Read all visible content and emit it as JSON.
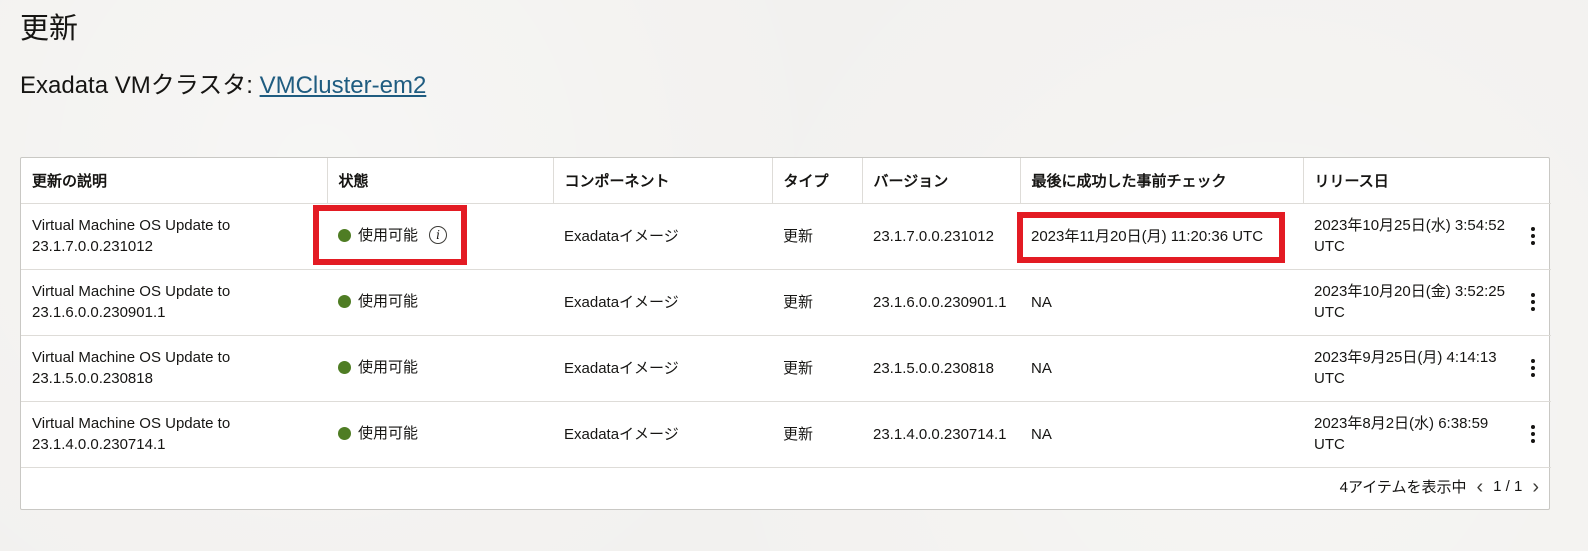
{
  "page": {
    "title": "更新",
    "subtitle_prefix": "Exadata VMクラスタ: ",
    "cluster_link": "VMCluster-em2"
  },
  "table": {
    "headers": [
      "更新の説明",
      "状態",
      "コンポーネント",
      "タイプ",
      "バージョン",
      "最後に成功した事前チェック",
      "リリース日"
    ],
    "rows": [
      {
        "desc_line1": "Virtual Machine OS Update to",
        "desc_line2": "23.1.7.0.0.231012",
        "status": "使用可能",
        "component": "Exadataイメージ",
        "type": "更新",
        "version": "23.1.7.0.0.231012",
        "precheck": "2023年11月20日(月) 11:20:36 UTC",
        "release_line1": "2023年10月25日(水) 3:54:52",
        "release_line2": "UTC"
      },
      {
        "desc_line1": "Virtual Machine OS Update to",
        "desc_line2": "23.1.6.0.0.230901.1",
        "status": "使用可能",
        "component": "Exadataイメージ",
        "type": "更新",
        "version": "23.1.6.0.0.230901.1",
        "precheck": "NA",
        "release_line1": "2023年10月20日(金) 3:52:25",
        "release_line2": "UTC"
      },
      {
        "desc_line1": "Virtual Machine OS Update to",
        "desc_line2": "23.1.5.0.0.230818",
        "status": "使用可能",
        "component": "Exadataイメージ",
        "type": "更新",
        "version": "23.1.5.0.0.230818",
        "precheck": "NA",
        "release_line1": "2023年9月25日(月) 4:14:13",
        "release_line2": "UTC"
      },
      {
        "desc_line1": "Virtual Machine OS Update to",
        "desc_line2": "23.1.4.0.0.230714.1",
        "status": "使用可能",
        "component": "Exadataイメージ",
        "type": "更新",
        "version": "23.1.4.0.0.230714.1",
        "precheck": "NA",
        "release_line1": "2023年8月2日(水) 6:38:59",
        "release_line2": "UTC"
      }
    ]
  },
  "footer": {
    "items_text": "4アイテムを表示中",
    "page_indicator": "1 / 1"
  },
  "icons": {
    "status": "status-available-dot",
    "info": "info-icon",
    "actions": "kebab-menu-icon",
    "prev": "chevron-left-icon",
    "next": "chevron-right-icon"
  },
  "colors": {
    "status_available": "#4f7d24",
    "link": "#1f5c80",
    "highlight": "#e31b23"
  }
}
